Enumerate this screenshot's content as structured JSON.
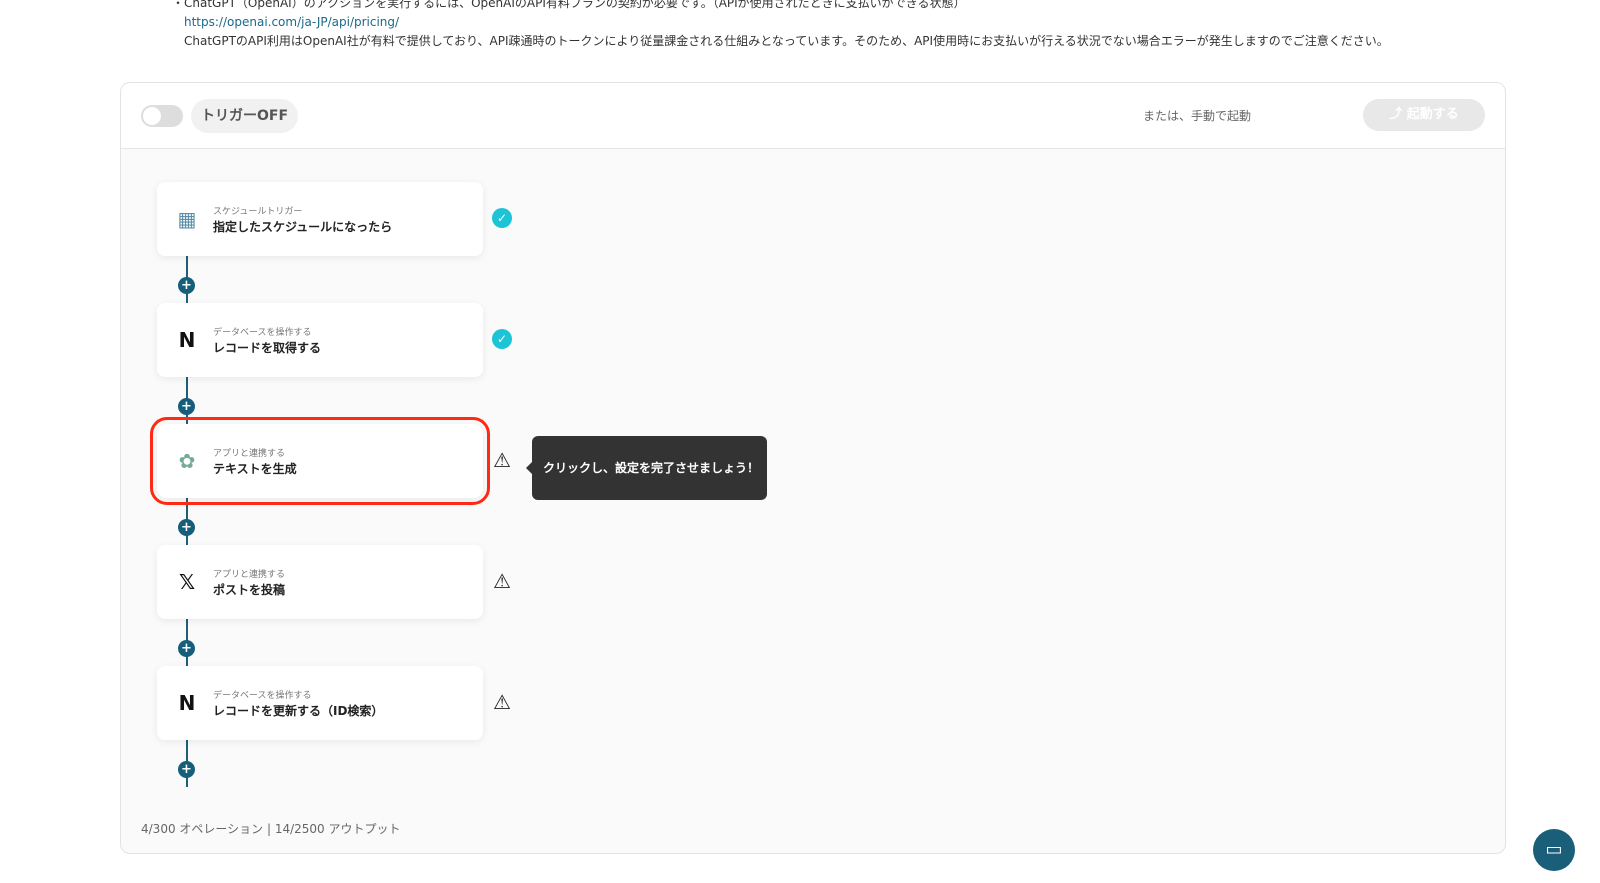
{
  "notes": {
    "line1": "・ChatGPT（OpenAI）のアクションを実行するには、OpenAIのAPI有料プランの契約が必要です。（APIが使用されたときに支払いができる状態）",
    "link": "https://openai.com/ja-JP/api/pricing/",
    "line3": "ChatGPTのAPI利用はOpenAI社が有料で提供しており、API疎通時のトークンにより従量課金される仕組みとなっています。そのため、API使用時にお支払いが行える状況でない場合エラーが発生しますのでご注意ください。"
  },
  "header": {
    "trigger_label": "トリガーOFF",
    "manual_label": "または、手動で起動",
    "start_label": "⤴ 起動する"
  },
  "steps": [
    {
      "sub": "スケジュールトリガー",
      "title": "指定したスケジュールになったら",
      "icon": "calendar-icon",
      "status": "ok"
    },
    {
      "sub": "データベースを操作する",
      "title": "レコードを取得する",
      "icon": "notion-icon",
      "status": "ok"
    },
    {
      "sub": "アプリと連携する",
      "title": "テキストを生成",
      "icon": "chatgpt-icon",
      "status": "warning"
    },
    {
      "sub": "アプリと連携する",
      "title": "ポストを投稿",
      "icon": "x-icon",
      "status": "warning"
    },
    {
      "sub": "データベースを操作する",
      "title": "レコードを更新する（ID検索）",
      "icon": "notion-icon",
      "status": "warning"
    }
  ],
  "tooltip": "クリックし、設定を完了させましょう！",
  "footer": "4/300 オペレーション | 14/2500 アウトプット",
  "colors": {
    "accent": "#175e7a",
    "ok": "#1cc4d6",
    "highlight": "#ff2a14"
  }
}
